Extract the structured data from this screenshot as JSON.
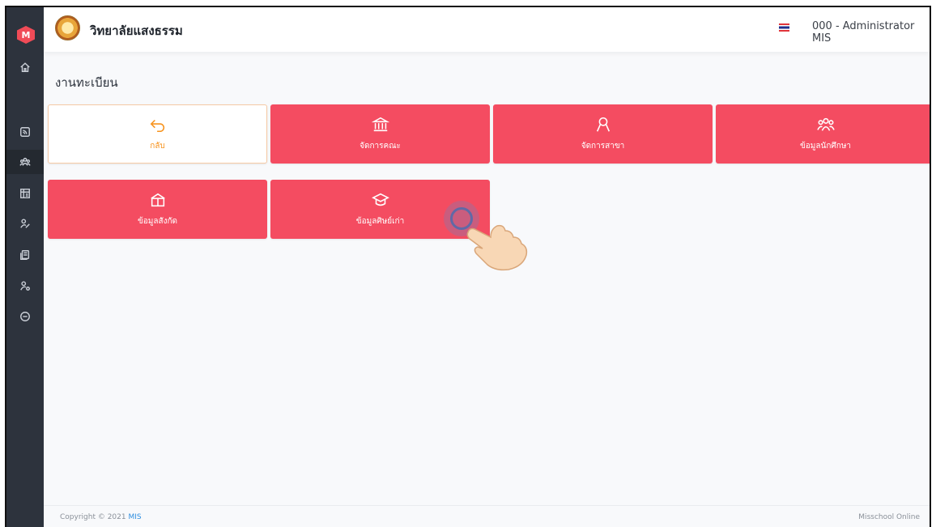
{
  "app": {
    "brand_letter": "M",
    "school_name": "วิทยาลัยแสงธรรม",
    "user_label": "000 - Administrator MIS",
    "language_flag": "thai-flag-icon"
  },
  "sidebar": {
    "items": [
      {
        "name": "home",
        "icon": "home-icon"
      },
      {
        "name": "rss",
        "icon": "rss-icon"
      },
      {
        "name": "registration",
        "icon": "group-icon",
        "active": true
      },
      {
        "name": "grid",
        "icon": "grid-icon"
      },
      {
        "name": "users",
        "icon": "user-edit-icon"
      },
      {
        "name": "documents",
        "icon": "document-icon"
      },
      {
        "name": "user-settings",
        "icon": "user-gear-icon"
      },
      {
        "name": "logout",
        "icon": "logout-icon"
      }
    ]
  },
  "main": {
    "title": "งานทะเบียน",
    "tiles": [
      {
        "label": "กลับ",
        "icon": "back-arrow-icon"
      },
      {
        "label": "จัดการคณะ",
        "icon": "institution-icon"
      },
      {
        "label": "จัดการสาขา",
        "icon": "user-icon"
      },
      {
        "label": "ข้อมูลนักศึกษา",
        "icon": "group-icon"
      },
      {
        "label": "ข้อมูลสังกัด",
        "icon": "book-icon"
      },
      {
        "label": "ข้อมูลศิษย์เก่า",
        "icon": "graduation-cap-icon"
      }
    ]
  },
  "footer": {
    "copyright": "Copyright © 2021 ",
    "copyright_link": "MIS",
    "brand": "Misschool Online"
  },
  "colors": {
    "tile": "#f44c61",
    "back_accent": "#f7931e",
    "sidebar": "#2d333d"
  }
}
